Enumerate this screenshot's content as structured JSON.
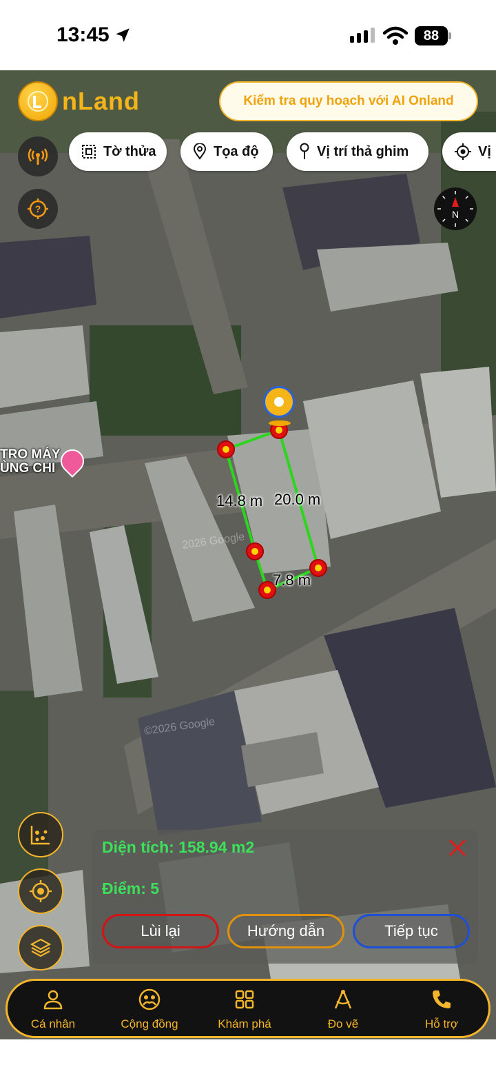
{
  "status_bar": {
    "time": "13:45",
    "battery": "88"
  },
  "header": {
    "logo_text": "nLand",
    "ai_button": "Kiểm tra quy hoạch với AI Onland"
  },
  "chips": [
    {
      "label": "Tờ thửa",
      "icon": "parcel-icon"
    },
    {
      "label": "Tọa độ",
      "icon": "location-pin-icon"
    },
    {
      "label": "Vị trí thả ghim",
      "icon": "pin-drop-icon"
    },
    {
      "label": "Vị",
      "icon": "target-icon"
    }
  ],
  "compass": {
    "label": "N"
  },
  "map": {
    "poi_label_line1": "TRO MÁY",
    "poi_label_line2": "ÙNG CHI",
    "watermark_1": "2026 Google",
    "watermark_2": "©2026 Google"
  },
  "measurement": {
    "edge_labels": [
      "14.8 m",
      "20.0 m",
      "7.8 m"
    ],
    "colors": {
      "edge": "#2cd61e",
      "vertex": "#e11010"
    }
  },
  "info_panel": {
    "area": "Diện tích: 158.94 m2",
    "points": "Điểm: 5",
    "buttons": {
      "back": "Lùi lại",
      "guide": "Hướng dẫn",
      "next": "Tiếp tục"
    },
    "colors": {
      "back": "#d21414",
      "guide": "#e0920c",
      "next": "#1d4fd8",
      "text_green": "#3ce05a"
    }
  },
  "bottom_nav": [
    {
      "label": "Cá nhân",
      "icon": "person-icon"
    },
    {
      "label": "Cộng đồng",
      "icon": "community-icon"
    },
    {
      "label": "Khám phá",
      "icon": "grid-icon"
    },
    {
      "label": "Đo vẽ",
      "icon": "measure-icon"
    },
    {
      "label": "Hỗ trợ",
      "icon": "phone-icon"
    }
  ],
  "accent_color": "#f3b52a"
}
